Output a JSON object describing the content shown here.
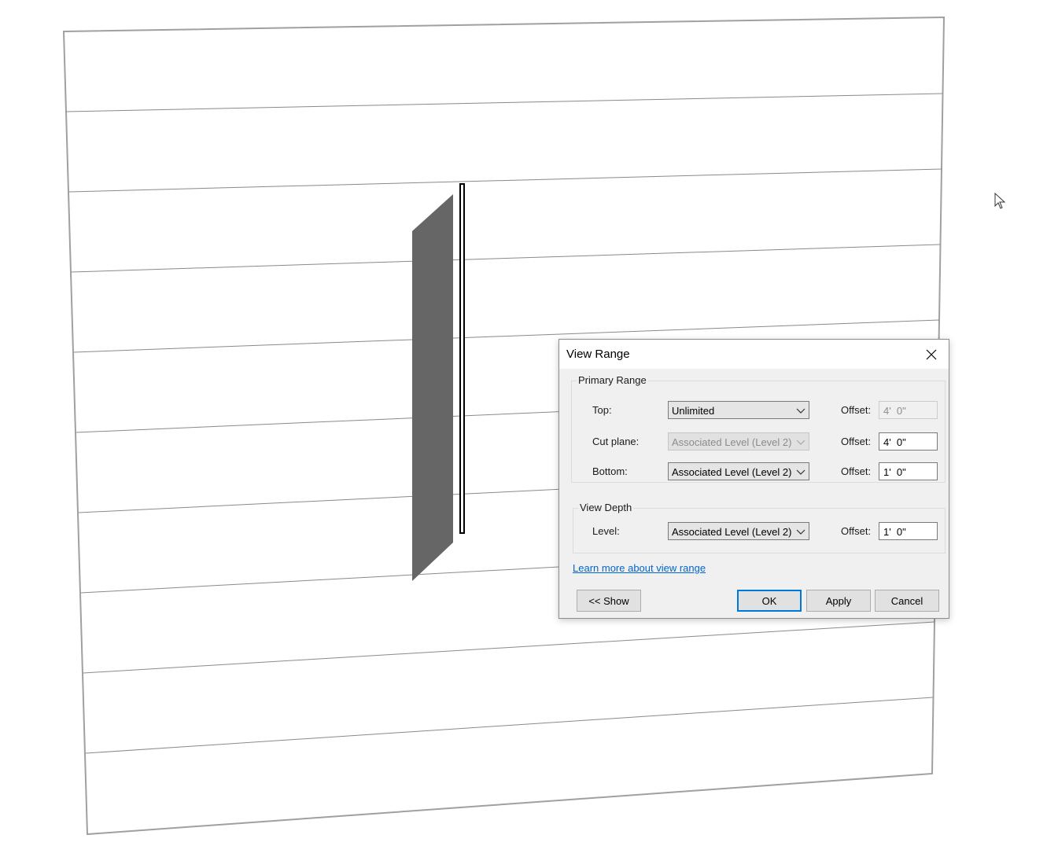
{
  "dialog": {
    "title": "View Range",
    "close_icon": "close-icon",
    "primary_range": {
      "label": "Primary Range",
      "rows": [
        {
          "label": "Top:",
          "level": "Unlimited",
          "level_enabled": true,
          "offset_label": "Offset:",
          "offset": "4'  0\"",
          "offset_enabled": false
        },
        {
          "label": "Cut plane:",
          "level": "Associated Level (Level 2)",
          "level_enabled": false,
          "offset_label": "Offset:",
          "offset": "4'  0\"",
          "offset_enabled": true
        },
        {
          "label": "Bottom:",
          "level": "Associated Level (Level 2)",
          "level_enabled": true,
          "offset_label": "Offset:",
          "offset": "1'  0\"",
          "offset_enabled": true
        }
      ]
    },
    "view_depth": {
      "label": "View Depth",
      "rows": [
        {
          "label": "Level:",
          "level": "Associated Level (Level 2)",
          "level_enabled": true,
          "offset_label": "Offset:",
          "offset": "1'  0\"",
          "offset_enabled": true
        }
      ]
    },
    "learn_more_link": "Learn more about view range",
    "buttons": {
      "show": "<< Show",
      "ok": "OK",
      "apply": "Apply",
      "cancel": "Cancel"
    }
  },
  "viewport": {
    "wall_color": "#666666",
    "line_color": "#8a8a8a",
    "edge_color": "#a0a0a0"
  },
  "cursor": {
    "icon": "mouse-pointer-icon"
  }
}
